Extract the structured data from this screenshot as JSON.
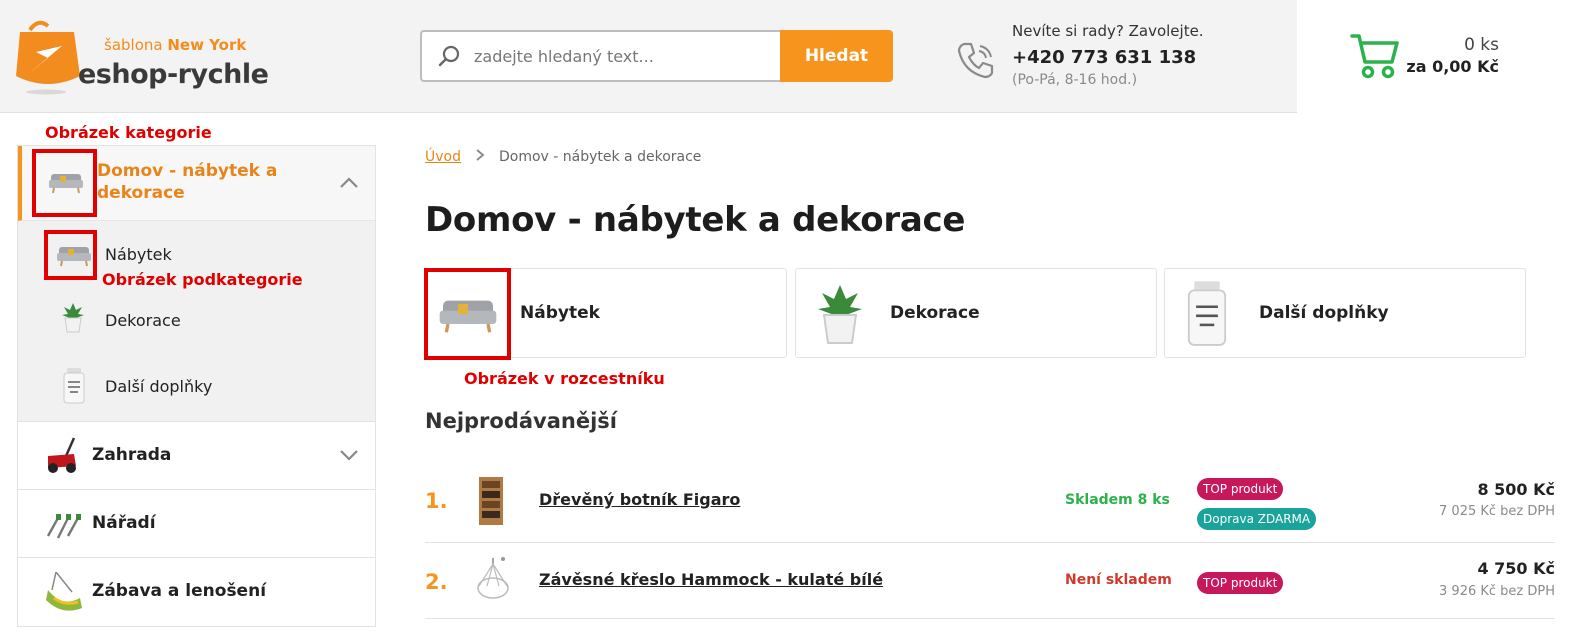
{
  "header": {
    "logo_small_prefix": "šablona ",
    "logo_small_name": "New York",
    "logo_big": "eshop-rychle",
    "search_placeholder": "zadejte hledaný text...",
    "search_button": "Hledat",
    "contact_question": "Nevíte si rady? Zavolejte.",
    "contact_phone": "+420 773 631 138",
    "contact_hours": "(Po-Pá, 8-16 hod.)",
    "cart_count": "0 ks",
    "cart_total": "za 0,00 Kč"
  },
  "annotations": {
    "category_image": "Obrázek kategorie",
    "subcategory_image": "Obrázek podkategorie",
    "signpost_image": "Obrázek v rozcestníku"
  },
  "sidebar": {
    "active_category": "Domov - nábytek a dekorace",
    "subcategories": [
      {
        "label": "Nábytek",
        "icon": "sofa-icon"
      },
      {
        "label": "Dekorace",
        "icon": "plant-pot-icon"
      },
      {
        "label": "Další doplňky",
        "icon": "jar-icon"
      }
    ],
    "categories": [
      {
        "label": "Zahrada",
        "icon": "lawnmower-icon"
      },
      {
        "label": "Nářadí",
        "icon": "tools-icon"
      },
      {
        "label": "Zábava a lenošení",
        "icon": "hammock-icon"
      }
    ]
  },
  "breadcrumb": {
    "home": "Úvod",
    "current": "Domov - nábytek a dekorace"
  },
  "main": {
    "title": "Domov - nábytek a dekorace",
    "cards": [
      {
        "label": "Nábytek",
        "icon": "sofa-icon"
      },
      {
        "label": "Dekorace",
        "icon": "plant-pot-icon"
      },
      {
        "label": "Další doplňky",
        "icon": "jar-icon"
      }
    ],
    "bestsellers_title": "Nejprodávanější",
    "products": [
      {
        "rank": "1.",
        "name": "Dřevěný botník Figaro",
        "stock": "Skladem 8 ks",
        "stock_color": "#2bb24c",
        "badges": [
          {
            "label": "TOP produkt",
            "color": "#c8185c"
          },
          {
            "label": "Doprava ZDARMA",
            "color": "#1aa39a"
          }
        ],
        "price": "8 500 Kč",
        "price_ex": "7 025 Kč bez DPH"
      },
      {
        "rank": "2.",
        "name": "Závěsné křeslo Hammock - kulaté bílé",
        "stock": "Není skladem",
        "stock_color": "#d0392b",
        "badges": [
          {
            "label": "TOP produkt",
            "color": "#c8185c"
          }
        ],
        "price": "4 750 Kč",
        "price_ex": "3 926 Kč bez DPH"
      }
    ]
  },
  "colors": {
    "accent": "#f7941d",
    "annotation": "#e00000",
    "cart": "#2bb24c"
  }
}
